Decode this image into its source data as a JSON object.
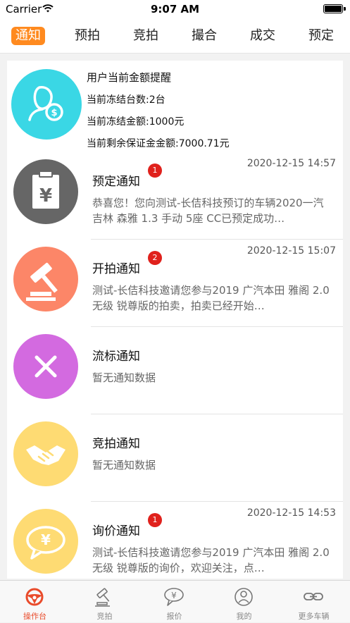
{
  "status_bar": {
    "carrier": "Carrier",
    "time": "9:07 AM"
  },
  "tabs": [
    {
      "label": "通知",
      "active": true
    },
    {
      "label": "预拍",
      "active": false
    },
    {
      "label": "竞拍",
      "active": false
    },
    {
      "label": "撮合",
      "active": false
    },
    {
      "label": "成交",
      "active": false
    },
    {
      "label": "预定",
      "active": false
    }
  ],
  "reminder": {
    "title": "用户当前金额提醒",
    "frozen_count": "当前冻结台数:2台",
    "frozen_amount": "当前冻结金额:1000元",
    "remaining_deposit": "当前剩余保证金金额:7000.71元"
  },
  "notices": [
    {
      "title": "预定通知",
      "badge": "1",
      "time": "2020-12-15 14:57",
      "desc": "恭喜您！您向测试-长佶科技预订的车辆2020一汽吉林 森雅 1.3 手动 5座 CC已预定成功…",
      "icon": "clipboard-yen-icon",
      "color": "#666666"
    },
    {
      "title": "开拍通知",
      "badge": "2",
      "time": "2020-12-15 15:07",
      "desc": "测试-长佶科技邀请您参与2019 广汽本田 雅阁 2.0 无级 锐尊版的拍卖，拍卖已经开始…",
      "icon": "gavel-icon",
      "color": "#fc8668"
    },
    {
      "title": "流标通知",
      "badge": "",
      "time": "",
      "desc": "暂无通知数据",
      "icon": "close-x-icon",
      "color": "#d36ae0"
    },
    {
      "title": "竞拍通知",
      "badge": "",
      "time": "",
      "desc": "暂无通知数据",
      "icon": "handshake-icon",
      "color": "#fedb73"
    },
    {
      "title": "询价通知",
      "badge": "1",
      "time": "2020-12-15 14:53",
      "desc": "测试-长佶科技邀请您参与2019 广汽本田 雅阁 2.0 无级 锐尊版的询价，欢迎关注，点…",
      "icon": "speech-yen-icon",
      "color": "#fedb73"
    }
  ],
  "tabbar": [
    {
      "label": "操作台",
      "icon": "steering-wheel-icon",
      "active": true
    },
    {
      "label": "竞拍",
      "icon": "gavel-icon",
      "active": false
    },
    {
      "label": "报价",
      "icon": "yen-bubble-icon",
      "active": false
    },
    {
      "label": "我的",
      "icon": "user-icon",
      "active": false
    },
    {
      "label": "更多车辆",
      "icon": "link-icon",
      "active": false
    }
  ],
  "colors": {
    "accent": "#ff8a1f",
    "badge": "#e0211c",
    "reminder_avatar": "#3ad7e5",
    "tabbar_active": "#e94b2b"
  }
}
